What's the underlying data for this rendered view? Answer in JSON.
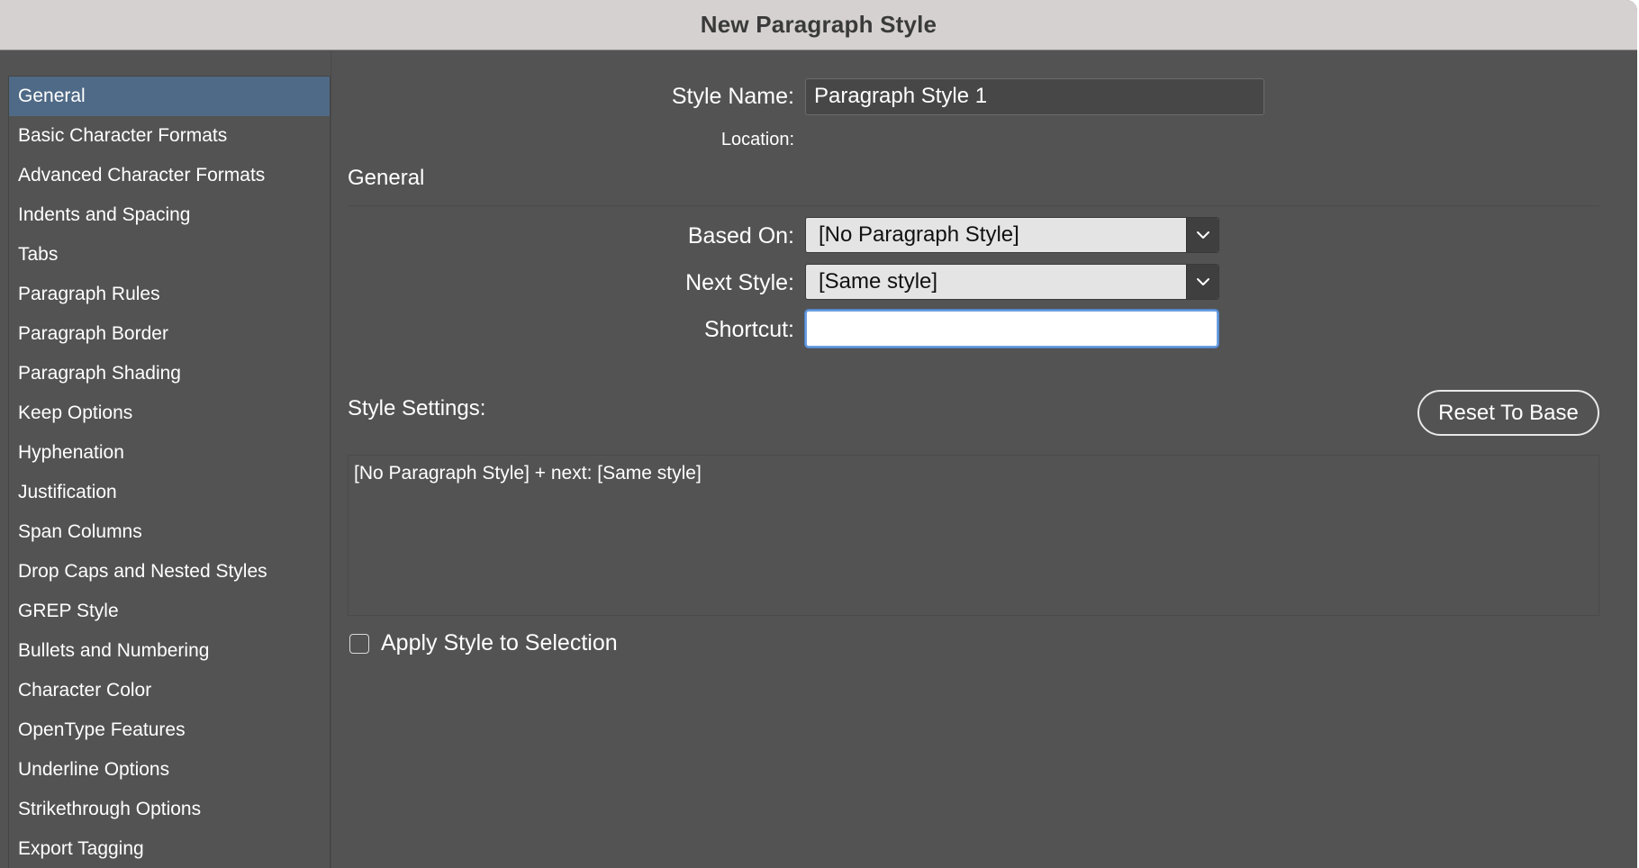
{
  "window": {
    "title": "New Paragraph Style"
  },
  "sidebar": {
    "items": [
      {
        "label": "General",
        "selected": true
      },
      {
        "label": "Basic Character Formats"
      },
      {
        "label": "Advanced Character Formats"
      },
      {
        "label": "Indents and Spacing"
      },
      {
        "label": "Tabs"
      },
      {
        "label": "Paragraph Rules"
      },
      {
        "label": "Paragraph Border"
      },
      {
        "label": "Paragraph Shading"
      },
      {
        "label": "Keep Options"
      },
      {
        "label": "Hyphenation"
      },
      {
        "label": "Justification"
      },
      {
        "label": "Span Columns"
      },
      {
        "label": "Drop Caps and Nested Styles"
      },
      {
        "label": "GREP Style"
      },
      {
        "label": "Bullets and Numbering"
      },
      {
        "label": "Character Color"
      },
      {
        "label": "OpenType Features"
      },
      {
        "label": "Underline Options"
      },
      {
        "label": "Strikethrough Options"
      },
      {
        "label": "Export Tagging"
      }
    ]
  },
  "header": {
    "style_name_label": "Style Name:",
    "style_name_value": "Paragraph Style 1",
    "location_label": "Location:"
  },
  "general": {
    "heading": "General",
    "based_on_label": "Based On:",
    "based_on_value": "[No Paragraph Style]",
    "next_style_label": "Next Style:",
    "next_style_value": "[Same style]",
    "shortcut_label": "Shortcut:",
    "shortcut_value": ""
  },
  "style_settings": {
    "label": "Style Settings:",
    "reset_button": "Reset To Base",
    "summary": "[No Paragraph Style] + next: [Same style]"
  },
  "apply_checkbox": {
    "label": "Apply Style to Selection",
    "checked": false
  },
  "colors": {
    "dialog_bg": "#535353",
    "titlebar_bg": "#d6d1d1",
    "selected_item_bg": "#4f6a86",
    "focus_ring": "#6b9ee0"
  },
  "icons": {
    "dropdown": "chevron-down-icon"
  }
}
